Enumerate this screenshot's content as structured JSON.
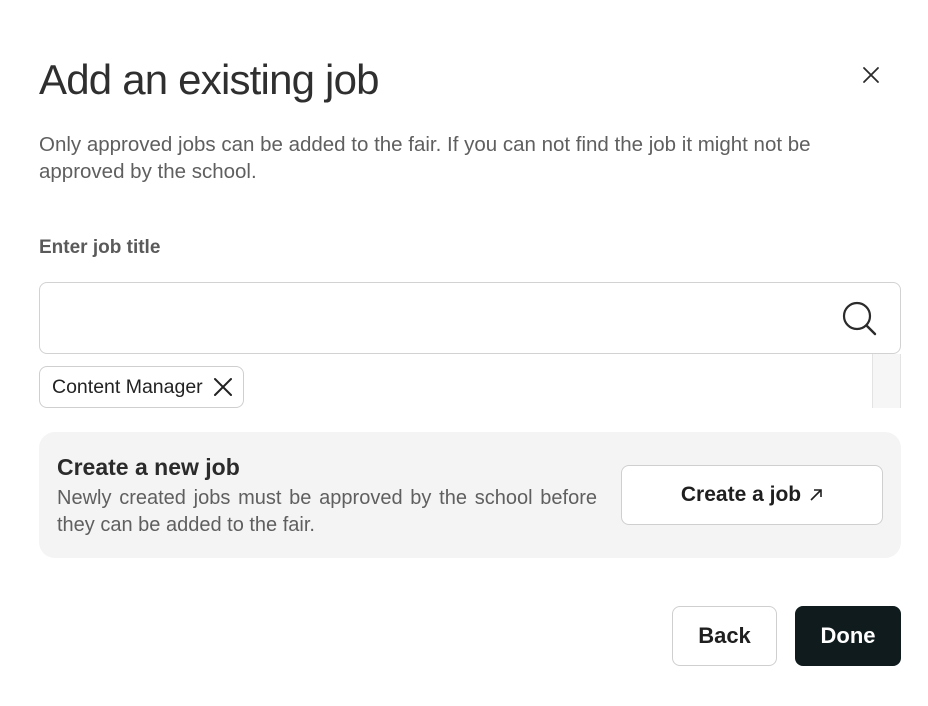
{
  "dialog": {
    "title": "Add an existing job",
    "description": "Only approved jobs can be added to the fair. If you can not find the job it might not be approved by the school.",
    "close_icon": "close-icon"
  },
  "search": {
    "label": "Enter job title",
    "value": "",
    "placeholder": "",
    "icon": "search-icon"
  },
  "selected_jobs": [
    {
      "label": "Content Manager",
      "remove_icon": "close-icon"
    }
  ],
  "create_card": {
    "title": "Create a new job",
    "description": "Newly created jobs must be approved by the school before they can be added to the fair.",
    "button_label": "Create a job",
    "button_icon": "external-link-icon"
  },
  "footer": {
    "back_label": "Back",
    "done_label": "Done"
  },
  "colors": {
    "primary_button": "#0f1b1d",
    "card_background": "#f4f4f4",
    "border": "#cfcfcf"
  }
}
